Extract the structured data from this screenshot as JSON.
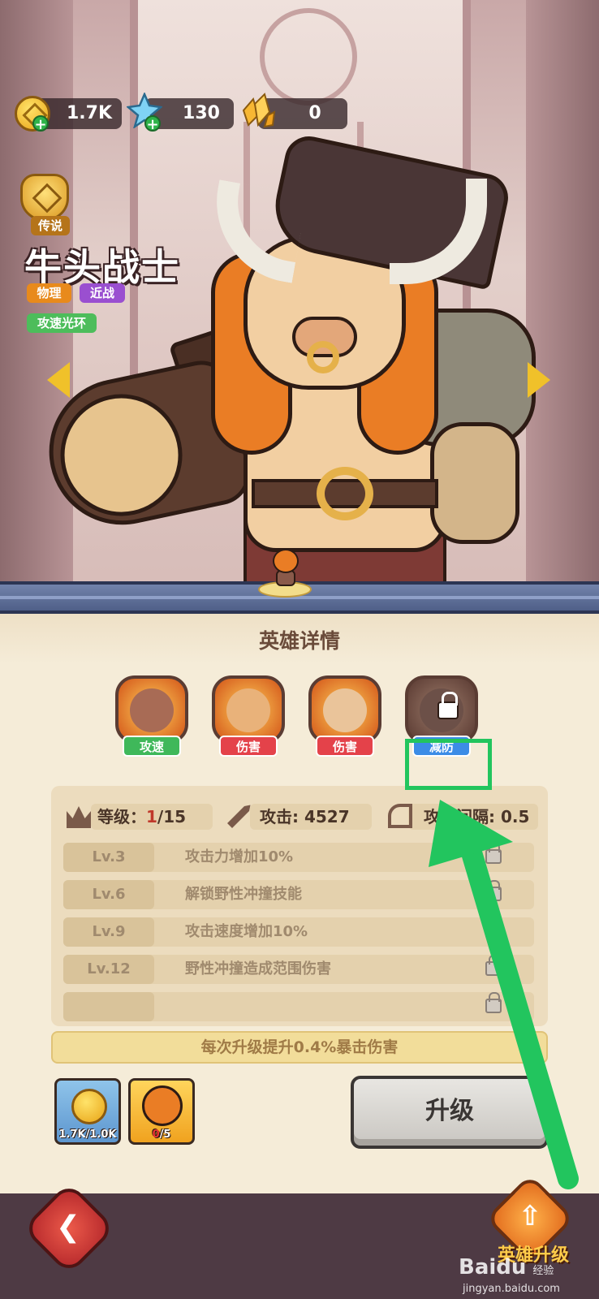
{
  "currency": {
    "gold": "1.7K",
    "crystal": "130",
    "shard": "0"
  },
  "hero": {
    "rank_label": "传说",
    "name": "牛头战士",
    "tags": [
      "物理",
      "近战",
      "攻速光环"
    ]
  },
  "panel": {
    "title": "英雄详情",
    "skills": [
      {
        "label": "攻速",
        "color": "#3fb85a",
        "locked": false
      },
      {
        "label": "伤害",
        "color": "#e4424a",
        "locked": false
      },
      {
        "label": "伤害",
        "color": "#e4424a",
        "locked": false
      },
      {
        "label": "减防",
        "color": "#3c8ce6",
        "locked": true
      }
    ],
    "stats": {
      "level_label": "等级：",
      "level_current": "1",
      "level_max": "/15",
      "attack_label": "攻击:",
      "attack_value": "4527",
      "interval_label": "攻击间隔:",
      "interval_value": "0.5"
    },
    "level_rewards": [
      {
        "lvl": "Lv.3",
        "desc": "攻击力增加10%"
      },
      {
        "lvl": "Lv.6",
        "desc": "解锁野性冲撞技能"
      },
      {
        "lvl": "Lv.9",
        "desc": "攻击速度增加10%"
      },
      {
        "lvl": "Lv.12",
        "desc": "野性冲撞造成范围伤害"
      }
    ],
    "bonus_text": "每次升级提升0.4%暴击伤害",
    "cost_gold": "1.7K/1.0K",
    "cost_hero_have": "0",
    "cost_hero_need": "/5",
    "upgrade_label": "升级"
  },
  "bottom": {
    "hero_upgrade_label": "英雄升级"
  },
  "watermark": {
    "logo": "Baidu",
    "sub": "经验",
    "url": "jingyan.baidu.com"
  },
  "annotation_color": "#22c55e"
}
